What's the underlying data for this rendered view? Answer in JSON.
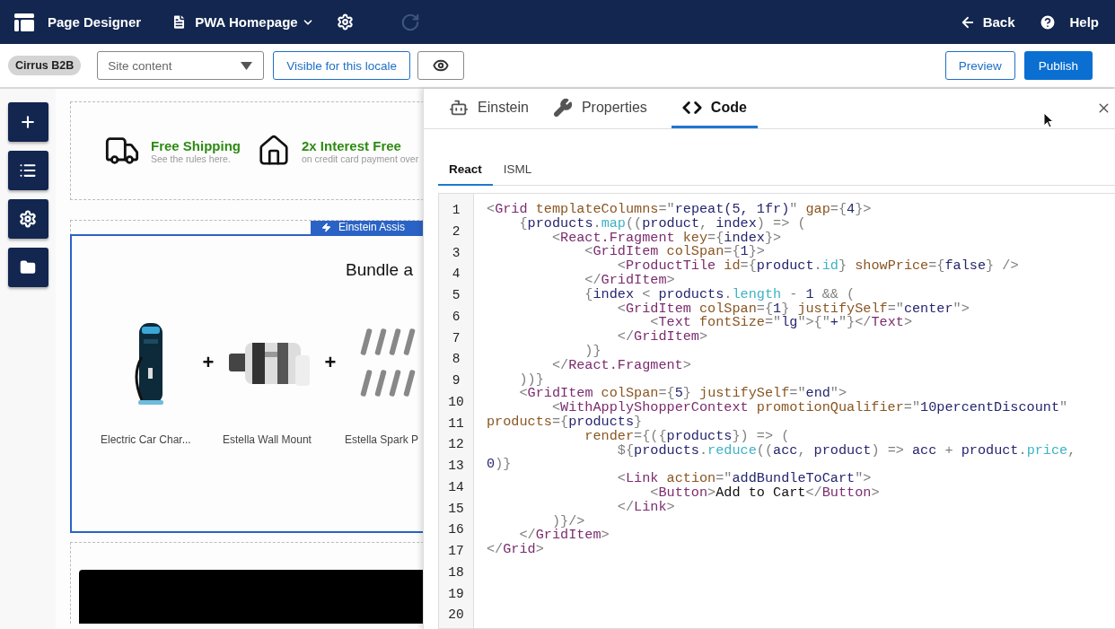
{
  "top_bar": {
    "title": "Page Designer",
    "page_menu": "PWA Homepage",
    "redo": {
      "disabled": true
    },
    "back": "Back",
    "help": "Help"
  },
  "toolbar": {
    "site": "Cirrus B2B",
    "content_select": {
      "value": "Site content"
    },
    "visibility_button": "Visible for this locale",
    "preview": "Preview",
    "publish": "Publish"
  },
  "canvas": {
    "promos": [
      {
        "title": "Free Shipping",
        "subtitle": "See the rules here."
      },
      {
        "title": "2x Interest Free",
        "subtitle": "on credit card payment over"
      }
    ],
    "component_badge": "Einstein Assis",
    "component": {
      "title": "Bundle a",
      "selected": true,
      "separator": "+",
      "products": [
        {
          "name": "Electric Car Char..."
        },
        {
          "name": "Estella Wall Mount"
        },
        {
          "name": "Estella Spark P"
        }
      ]
    }
  },
  "panel": {
    "tabs": [
      {
        "label": "Einstein",
        "selected": false
      },
      {
        "label": "Properties",
        "selected": false
      },
      {
        "label": "Code",
        "selected": true
      }
    ],
    "sub_tabs": [
      {
        "label": "React",
        "selected": true
      },
      {
        "label": "ISML",
        "selected": false
      }
    ],
    "editor": {
      "line_numbers": [
        "1",
        "2",
        "3",
        "4",
        "5",
        "6",
        "7",
        "8",
        "9",
        "10",
        "11",
        "12",
        "13",
        "14",
        "15",
        "16",
        "17",
        "18",
        "19",
        "20"
      ],
      "lines": [
        [
          {
            "t": "<",
            "kind": "punct"
          },
          {
            "t": "Grid",
            "kind": "tag"
          },
          {
            "t": " templateColumns",
            "kind": "attr"
          },
          {
            "t": "=\"",
            "kind": "punct"
          },
          {
            "t": "repeat(5, 1fr)",
            "kind": "value"
          },
          {
            "t": "\"",
            "kind": "punct"
          },
          {
            "t": " gap",
            "kind": "attr"
          },
          {
            "t": "={",
            "kind": "punct"
          },
          {
            "t": "4",
            "kind": "value"
          },
          {
            "t": "}>",
            "kind": "punct"
          }
        ],
        [
          {
            "t": "    {",
            "kind": "punct"
          },
          {
            "t": "products",
            "kind": "value"
          },
          {
            "t": ".",
            "kind": "punct"
          },
          {
            "t": "map",
            "kind": "member"
          },
          {
            "t": "((",
            "kind": "punct"
          },
          {
            "t": "product",
            "kind": "value"
          },
          {
            "t": ", ",
            "kind": "punct"
          },
          {
            "t": "index",
            "kind": "value"
          },
          {
            "t": ") => (",
            "kind": "punct"
          }
        ],
        [
          {
            "t": "        <",
            "kind": "punct"
          },
          {
            "t": "React.Fragment",
            "kind": "tag"
          },
          {
            "t": " key",
            "kind": "attr"
          },
          {
            "t": "={",
            "kind": "punct"
          },
          {
            "t": "index",
            "kind": "value"
          },
          {
            "t": "}>",
            "kind": "punct"
          }
        ],
        [
          {
            "t": "            <",
            "kind": "punct"
          },
          {
            "t": "GridItem",
            "kind": "tag"
          },
          {
            "t": " colSpan",
            "kind": "attr"
          },
          {
            "t": "={",
            "kind": "punct"
          },
          {
            "t": "1",
            "kind": "value"
          },
          {
            "t": "}>",
            "kind": "punct"
          }
        ],
        [
          {
            "t": "                <",
            "kind": "punct"
          },
          {
            "t": "ProductTile",
            "kind": "tag"
          },
          {
            "t": " id",
            "kind": "attr"
          },
          {
            "t": "={",
            "kind": "punct"
          },
          {
            "t": "product",
            "kind": "value"
          },
          {
            "t": ".",
            "kind": "punct"
          },
          {
            "t": "id",
            "kind": "member"
          },
          {
            "t": "}",
            "kind": "punct"
          },
          {
            "t": " showPrice",
            "kind": "attr"
          },
          {
            "t": "={",
            "kind": "punct"
          },
          {
            "t": "false",
            "kind": "value"
          },
          {
            "t": "} />",
            "kind": "punct"
          }
        ],
        [
          {
            "t": "            </",
            "kind": "punct"
          },
          {
            "t": "GridItem",
            "kind": "tag"
          },
          {
            "t": ">",
            "kind": "punct"
          }
        ],
        [
          {
            "t": "            {",
            "kind": "punct"
          },
          {
            "t": "index",
            "kind": "value"
          },
          {
            "t": " < ",
            "kind": "punct"
          },
          {
            "t": "products",
            "kind": "value"
          },
          {
            "t": ".",
            "kind": "punct"
          },
          {
            "t": "length",
            "kind": "member"
          },
          {
            "t": " - ",
            "kind": "punct"
          },
          {
            "t": "1",
            "kind": "value"
          },
          {
            "t": " && (",
            "kind": "punct"
          }
        ],
        [
          {
            "t": "                <",
            "kind": "punct"
          },
          {
            "t": "GridItem",
            "kind": "tag"
          },
          {
            "t": " colSpan",
            "kind": "attr"
          },
          {
            "t": "={",
            "kind": "punct"
          },
          {
            "t": "1",
            "kind": "value"
          },
          {
            "t": "}",
            "kind": "punct"
          },
          {
            "t": " justifySelf",
            "kind": "attr"
          },
          {
            "t": "=\"",
            "kind": "punct"
          },
          {
            "t": "center",
            "kind": "value"
          },
          {
            "t": "\">",
            "kind": "punct"
          }
        ],
        [
          {
            "t": "                    <",
            "kind": "punct"
          },
          {
            "t": "Text",
            "kind": "tag"
          },
          {
            "t": " fontSize",
            "kind": "attr"
          },
          {
            "t": "=\"",
            "kind": "punct"
          },
          {
            "t": "lg",
            "kind": "value"
          },
          {
            "t": "\">{\"",
            "kind": "punct"
          },
          {
            "t": "+",
            "kind": "value"
          },
          {
            "t": "\"}</",
            "kind": "punct"
          },
          {
            "t": "Text",
            "kind": "tag"
          },
          {
            "t": ">",
            "kind": "punct"
          }
        ],
        [
          {
            "t": "                </",
            "kind": "punct"
          },
          {
            "t": "GridItem",
            "kind": "tag"
          },
          {
            "t": ">",
            "kind": "punct"
          }
        ],
        [
          {
            "t": "            )}",
            "kind": "punct"
          }
        ],
        [
          {
            "t": "        </",
            "kind": "punct"
          },
          {
            "t": "React.Fragment",
            "kind": "tag"
          },
          {
            "t": ">",
            "kind": "punct"
          }
        ],
        [
          {
            "t": "    ))}",
            "kind": "punct"
          }
        ],
        [
          {
            "t": "    <",
            "kind": "punct"
          },
          {
            "t": "GridItem",
            "kind": "tag"
          },
          {
            "t": " colSpan",
            "kind": "attr"
          },
          {
            "t": "={",
            "kind": "punct"
          },
          {
            "t": "5",
            "kind": "value"
          },
          {
            "t": "}",
            "kind": "punct"
          },
          {
            "t": " justifySelf",
            "kind": "attr"
          },
          {
            "t": "=\"",
            "kind": "punct"
          },
          {
            "t": "end",
            "kind": "value"
          },
          {
            "t": "\">",
            "kind": "punct"
          }
        ],
        [
          {
            "t": "        <",
            "kind": "punct"
          },
          {
            "t": "WithApplyShopperContext",
            "kind": "tag"
          },
          {
            "t": " promotionQualifier",
            "kind": "attr"
          },
          {
            "t": "=\"",
            "kind": "punct"
          },
          {
            "t": "10percentDiscount",
            "kind": "value"
          },
          {
            "t": "\"",
            "kind": "punct"
          }
        ],
        [
          {
            "t": "products",
            "kind": "attr"
          },
          {
            "t": "={",
            "kind": "punct"
          },
          {
            "t": "products",
            "kind": "value"
          },
          {
            "t": "}",
            "kind": "punct"
          }
        ],
        [
          {
            "t": "            render",
            "kind": "attr"
          },
          {
            "t": "={({",
            "kind": "punct"
          },
          {
            "t": "products",
            "kind": "value"
          },
          {
            "t": "}) => (",
            "kind": "punct"
          }
        ],
        [
          {
            "t": "                ${",
            "kind": "punct"
          },
          {
            "t": "products",
            "kind": "value"
          },
          {
            "t": ".",
            "kind": "punct"
          },
          {
            "t": "reduce",
            "kind": "member"
          },
          {
            "t": "((",
            "kind": "punct"
          },
          {
            "t": "acc",
            "kind": "value"
          },
          {
            "t": ", ",
            "kind": "punct"
          },
          {
            "t": "product",
            "kind": "value"
          },
          {
            "t": ") => ",
            "kind": "punct"
          },
          {
            "t": "acc",
            "kind": "value"
          },
          {
            "t": " + ",
            "kind": "punct"
          },
          {
            "t": "product",
            "kind": "value"
          },
          {
            "t": ".",
            "kind": "punct"
          },
          {
            "t": "price",
            "kind": "member"
          },
          {
            "t": ",",
            "kind": "punct"
          }
        ],
        [
          {
            "t": "0",
            "kind": "value"
          },
          {
            "t": ")}",
            "kind": "punct"
          }
        ],
        [
          {
            "t": "                <",
            "kind": "punct"
          },
          {
            "t": "Link",
            "kind": "tag"
          },
          {
            "t": " action",
            "kind": "attr"
          },
          {
            "t": "=\"",
            "kind": "punct"
          },
          {
            "t": "addBundleToCart",
            "kind": "value"
          },
          {
            "t": "\">",
            "kind": "punct"
          }
        ],
        [
          {
            "t": "                    <",
            "kind": "punct"
          },
          {
            "t": "Button",
            "kind": "tag"
          },
          {
            "t": ">",
            "kind": "punct"
          },
          {
            "t": "Add to Cart",
            "kind": "plain"
          },
          {
            "t": "</",
            "kind": "punct"
          },
          {
            "t": "Button",
            "kind": "tag"
          },
          {
            "t": ">",
            "kind": "punct"
          }
        ],
        [
          {
            "t": "                </",
            "kind": "punct"
          },
          {
            "t": "Link",
            "kind": "tag"
          },
          {
            "t": ">",
            "kind": "punct"
          }
        ],
        [
          {
            "t": "        )}/>",
            "kind": "punct"
          }
        ],
        [
          {
            "t": "    </",
            "kind": "punct"
          },
          {
            "t": "GridItem",
            "kind": "tag"
          },
          {
            "t": ">",
            "kind": "punct"
          }
        ],
        [
          {
            "t": "</",
            "kind": "punct"
          },
          {
            "t": "Grid",
            "kind": "tag"
          },
          {
            "t": ">",
            "kind": "punct"
          }
        ]
      ]
    }
  }
}
